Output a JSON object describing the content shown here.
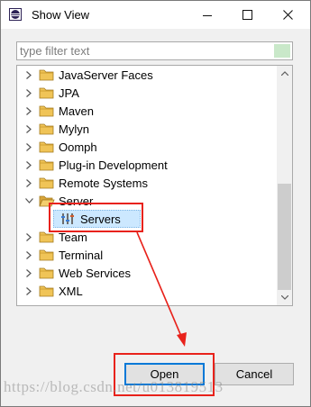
{
  "window": {
    "title": "Show View",
    "minimize_icon": "minimize-icon",
    "maximize_icon": "maximize-icon",
    "close_icon": "close-icon"
  },
  "filter": {
    "placeholder": "type filter text",
    "value": ""
  },
  "tree": {
    "items": [
      {
        "label": "JavaServer Faces",
        "expanded": false,
        "icon": "folder-icon"
      },
      {
        "label": "JPA",
        "expanded": false,
        "icon": "folder-icon"
      },
      {
        "label": "Maven",
        "expanded": false,
        "icon": "folder-icon"
      },
      {
        "label": "Mylyn",
        "expanded": false,
        "icon": "folder-icon"
      },
      {
        "label": "Oomph",
        "expanded": false,
        "icon": "folder-icon"
      },
      {
        "label": "Plug-in Development",
        "expanded": false,
        "icon": "folder-icon"
      },
      {
        "label": "Remote Systems",
        "expanded": false,
        "icon": "folder-icon"
      },
      {
        "label": "Server",
        "expanded": true,
        "icon": "open-folder-icon"
      },
      {
        "label": "Servers",
        "child": true,
        "selected": true,
        "icon": "servers-icon"
      },
      {
        "label": "Team",
        "expanded": false,
        "icon": "folder-icon"
      },
      {
        "label": "Terminal",
        "expanded": false,
        "icon": "folder-icon"
      },
      {
        "label": "Web Services",
        "expanded": false,
        "icon": "folder-icon"
      },
      {
        "label": "XML",
        "expanded": false,
        "icon": "folder-icon"
      }
    ]
  },
  "buttons": {
    "open": "Open",
    "cancel": "Cancel"
  },
  "colors": {
    "annotation": "#e8221b",
    "selection": "#cce8ff",
    "folder": "#e8b84a",
    "default_button_border": "#0078d7"
  },
  "watermark": "https://blog.csdn.net/u013819513"
}
